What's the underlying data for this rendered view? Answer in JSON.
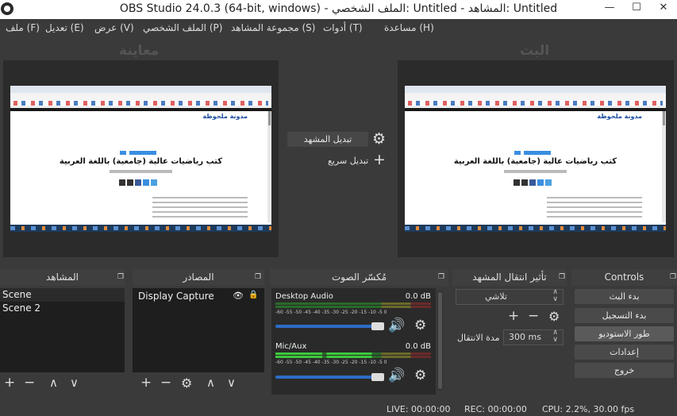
{
  "window": {
    "title": "OBS Studio 24.0.3 (64-bit, windows) - الملف الشخصي: Untitled - المشاهد: Untitled",
    "minimize": "—",
    "maximize": "☐",
    "close": "✕"
  },
  "menu": [
    "ملف (F)",
    "تعديل (E)",
    "عرض (V)",
    "الملف الشخصي (P)",
    "مجموعة المشاهد (S)",
    "أدوات (T)",
    "مساعدة (H)"
  ],
  "preview": {
    "left_title": "معاينة",
    "right_title": "البث",
    "site_logo": "مدونة ملحوظة",
    "article_heading": "كتب رياضيات عالية (جامعية) باللغة العربية"
  },
  "transition_controls": {
    "switch_scene": "تبديل المشهد",
    "quick_switch": "تبديل سريع"
  },
  "docks": {
    "scenes": {
      "title": "المشاهد",
      "items": [
        "Scene",
        "Scene 2"
      ],
      "selected": "Scene"
    },
    "sources": {
      "title": "المصادر",
      "items": [
        "Display Capture"
      ]
    },
    "mixer": {
      "title": "مُكسّر الصوت",
      "channels": [
        {
          "name": "Desktop Audio",
          "db": "0.0 dB"
        },
        {
          "name": "Mic/Aux",
          "db": "0.0 dB"
        }
      ],
      "scale": "-60 -55 -50 -45 -40 -35 -30 -25 -20 -15 -10 -5  0"
    },
    "transitions": {
      "title": "تأثير انتقال المشهد",
      "selected": "تلاشي",
      "duration_label": "مدة الانتقال",
      "duration_value": "300 ms"
    },
    "controls": {
      "title": "Controls",
      "buttons": [
        "بدء البث",
        "بدء التسجيل",
        "طور الاستوديو",
        "إعدادات",
        "خروج"
      ]
    }
  },
  "status": {
    "live": "LIVE: 00:00:00",
    "rec": "REC: 00:00:00",
    "cpu": "CPU: 2.2%, 30.00 fps"
  },
  "icons": {
    "plus": "+",
    "minus": "−",
    "up": "∧",
    "down": "∨",
    "gear": "⚙",
    "eye": "👁",
    "lock": "🔒",
    "speaker": "🔊",
    "float": "❐"
  },
  "colors": {
    "accent": "#2d6cc6",
    "meter_green": "#3cc83c",
    "meter_yellow": "#c8c83c",
    "meter_red": "#c83c3c"
  }
}
